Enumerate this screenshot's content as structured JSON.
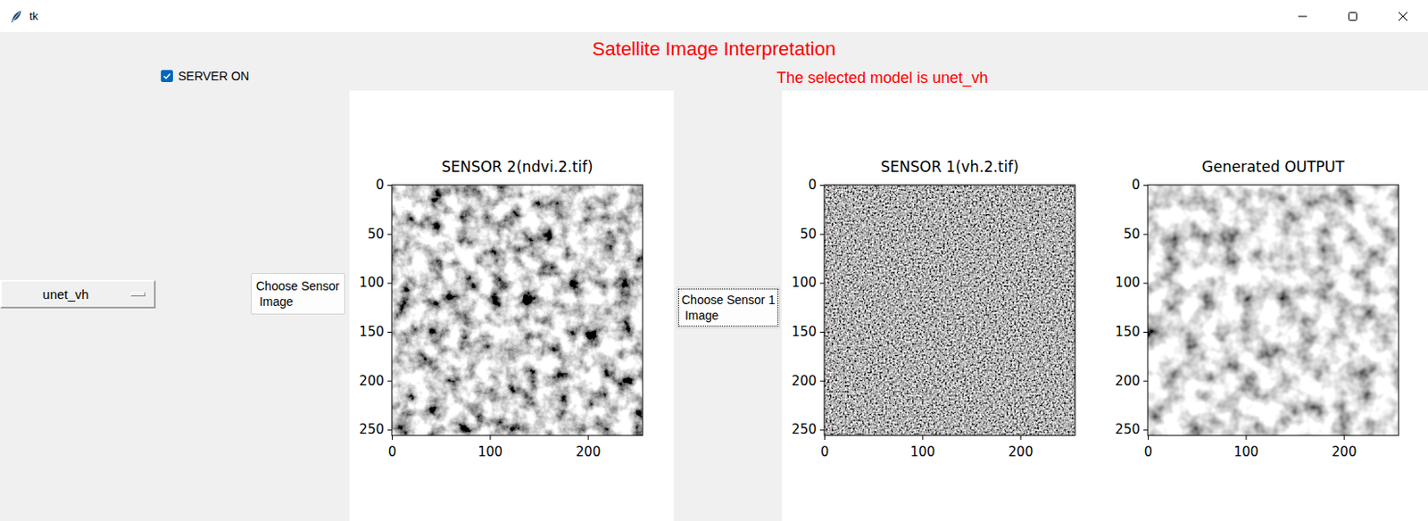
{
  "window": {
    "title": "tk"
  },
  "heading": "Satellite Image Interpretation",
  "server": {
    "label": "SERVER ON",
    "checked": true
  },
  "model_status": "The selected model is unet_vh",
  "model_select": {
    "value": "unet_vh"
  },
  "buttons": [
    {
      "label": "Choose Sensor\n Image",
      "focused": false
    },
    {
      "label": "Choose Sensor 1\n Image",
      "focused": true
    }
  ],
  "canvases": [
    {
      "figures": [
        {
          "title": "SENSOR 2(ndvi.2.tif)",
          "kind": "optical",
          "y_ticks": [
            "0",
            "50",
            "100",
            "150",
            "200",
            "250"
          ],
          "x_ticks": [
            "0",
            "100",
            "200"
          ]
        }
      ]
    },
    {
      "figures": [
        {
          "title": "SENSOR 1(vh.2.tif)",
          "kind": "radar",
          "y_ticks": [
            "0",
            "50",
            "100",
            "150",
            "200",
            "250"
          ],
          "x_ticks": [
            "0",
            "100",
            "200"
          ]
        },
        {
          "title": "Generated OUTPUT",
          "kind": "generated",
          "y_ticks": [
            "0",
            "50",
            "100",
            "150",
            "200",
            "250"
          ],
          "x_ticks": [
            "0",
            "100",
            "200"
          ]
        }
      ]
    }
  ]
}
